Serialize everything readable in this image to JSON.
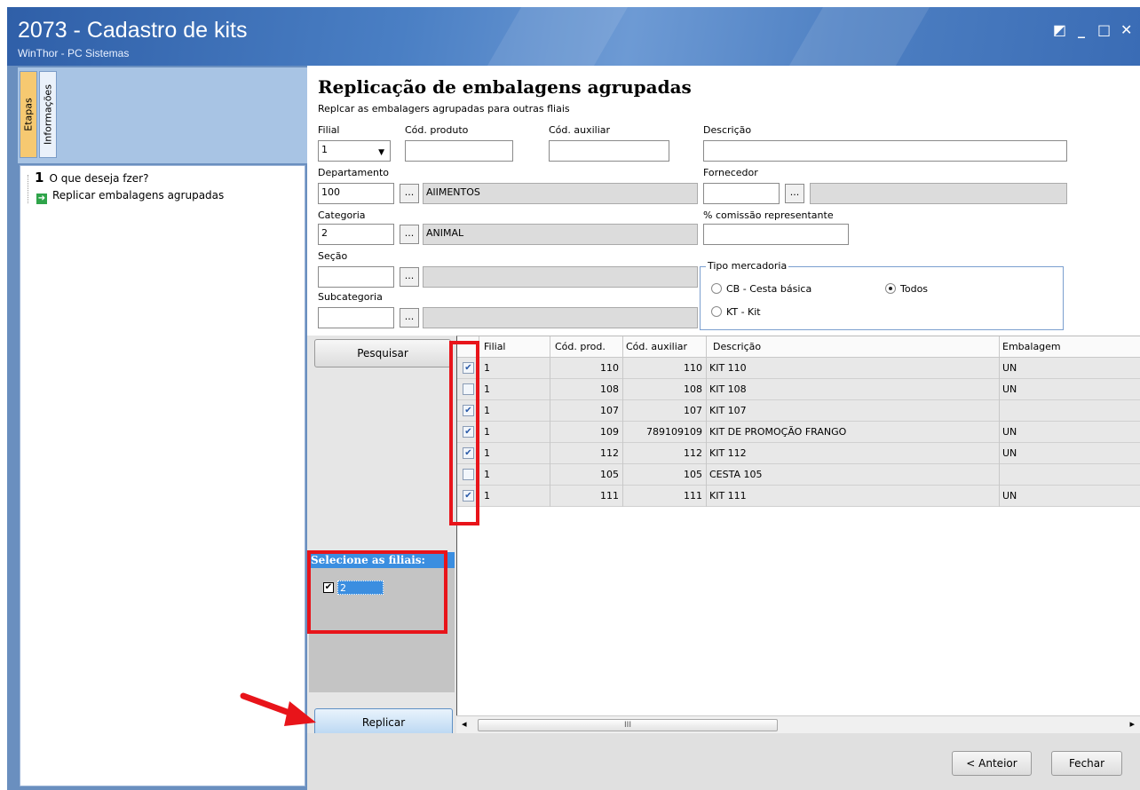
{
  "window": {
    "title": "2073 - Cadastro de kits",
    "subtitle": "WinThor - PC Sistemas",
    "controls": {
      "restore": "◩",
      "minimize": "_",
      "maximize": "□",
      "close": "✕"
    }
  },
  "sidebar": {
    "tabs": [
      {
        "label": "Etapas"
      },
      {
        "label": "Informações"
      }
    ],
    "steps": [
      {
        "number": "1",
        "label": "O que deseja fzer?"
      },
      {
        "label": "Replicar embalagens agrupadas"
      }
    ]
  },
  "page": {
    "title": "Replicação de embalagens agrupadas",
    "subtitle": "Replcar as embalagers agrupadas para outras fliais"
  },
  "form": {
    "filial": {
      "label": "Filial",
      "value": "1"
    },
    "cod_produto": {
      "label": "Cód. produto",
      "value": ""
    },
    "cod_auxiliar": {
      "label": "Cód. auxiliar",
      "value": ""
    },
    "descricao": {
      "label": "Descrição",
      "value": ""
    },
    "departamento": {
      "label": "Departamento",
      "code": "100",
      "name": "AlIMENTOS"
    },
    "fornecedor": {
      "label": "Fornecedor",
      "code": "",
      "name": ""
    },
    "categoria": {
      "label": "Categoria",
      "code": "2",
      "name": "ANIMAL"
    },
    "comissao": {
      "label": "% comissão representante",
      "value": ""
    },
    "secao": {
      "label": "Seção",
      "code": "",
      "name": ""
    },
    "subcategoria": {
      "label": "Subcategoria",
      "code": "",
      "name": ""
    },
    "dots_label": "...",
    "tipo_mercadoria": {
      "legend": "Tipo mercadoria",
      "options": [
        {
          "label": "CB - Cesta básica",
          "selected": false
        },
        {
          "label": "Todos",
          "selected": true
        },
        {
          "label": "KT - Kit",
          "selected": false
        }
      ]
    }
  },
  "buttons": {
    "pesquisar": "Pesquisar",
    "replicar": "Replicar",
    "anterior": "< Anteior",
    "fechar": "Fechar"
  },
  "filiais": {
    "header": "Selecione as filiais:",
    "items": [
      {
        "label": "2",
        "checked": true
      }
    ]
  },
  "grid": {
    "columns": [
      "Filial",
      "Cód. prod.",
      "Cód. auxiliar",
      "Descrição",
      "Embalagem"
    ],
    "rows": [
      {
        "checked": true,
        "filial": "1",
        "cod_prod": "110",
        "cod_aux": "110",
        "descricao": "KIT 110",
        "embalagem": "UN"
      },
      {
        "checked": false,
        "filial": "1",
        "cod_prod": "108",
        "cod_aux": "108",
        "descricao": "KIT 108",
        "embalagem": "UN"
      },
      {
        "checked": true,
        "filial": "1",
        "cod_prod": "107",
        "cod_aux": "107",
        "descricao": "KIT 107",
        "embalagem": ""
      },
      {
        "checked": true,
        "filial": "1",
        "cod_prod": "109",
        "cod_aux": "789109109",
        "descricao": "KIT DE PROMOÇÃO FRANGO",
        "embalagem": "UN"
      },
      {
        "checked": true,
        "filial": "1",
        "cod_prod": "112",
        "cod_aux": "112",
        "descricao": "KIT 112",
        "embalagem": "UN"
      },
      {
        "checked": false,
        "filial": "1",
        "cod_prod": "105",
        "cod_aux": "105",
        "descricao": "CESTA 105",
        "embalagem": ""
      },
      {
        "checked": true,
        "filial": "1",
        "cod_prod": "111",
        "cod_aux": "111",
        "descricao": "KIT 111",
        "embalagem": "UN"
      }
    ],
    "scroll": {
      "left": "◂",
      "right": "▸",
      "thumb": "III"
    }
  },
  "colors": {
    "title_bar": "#3a6cb5",
    "highlight": "#e8141a",
    "selection": "#3b8ee0"
  }
}
